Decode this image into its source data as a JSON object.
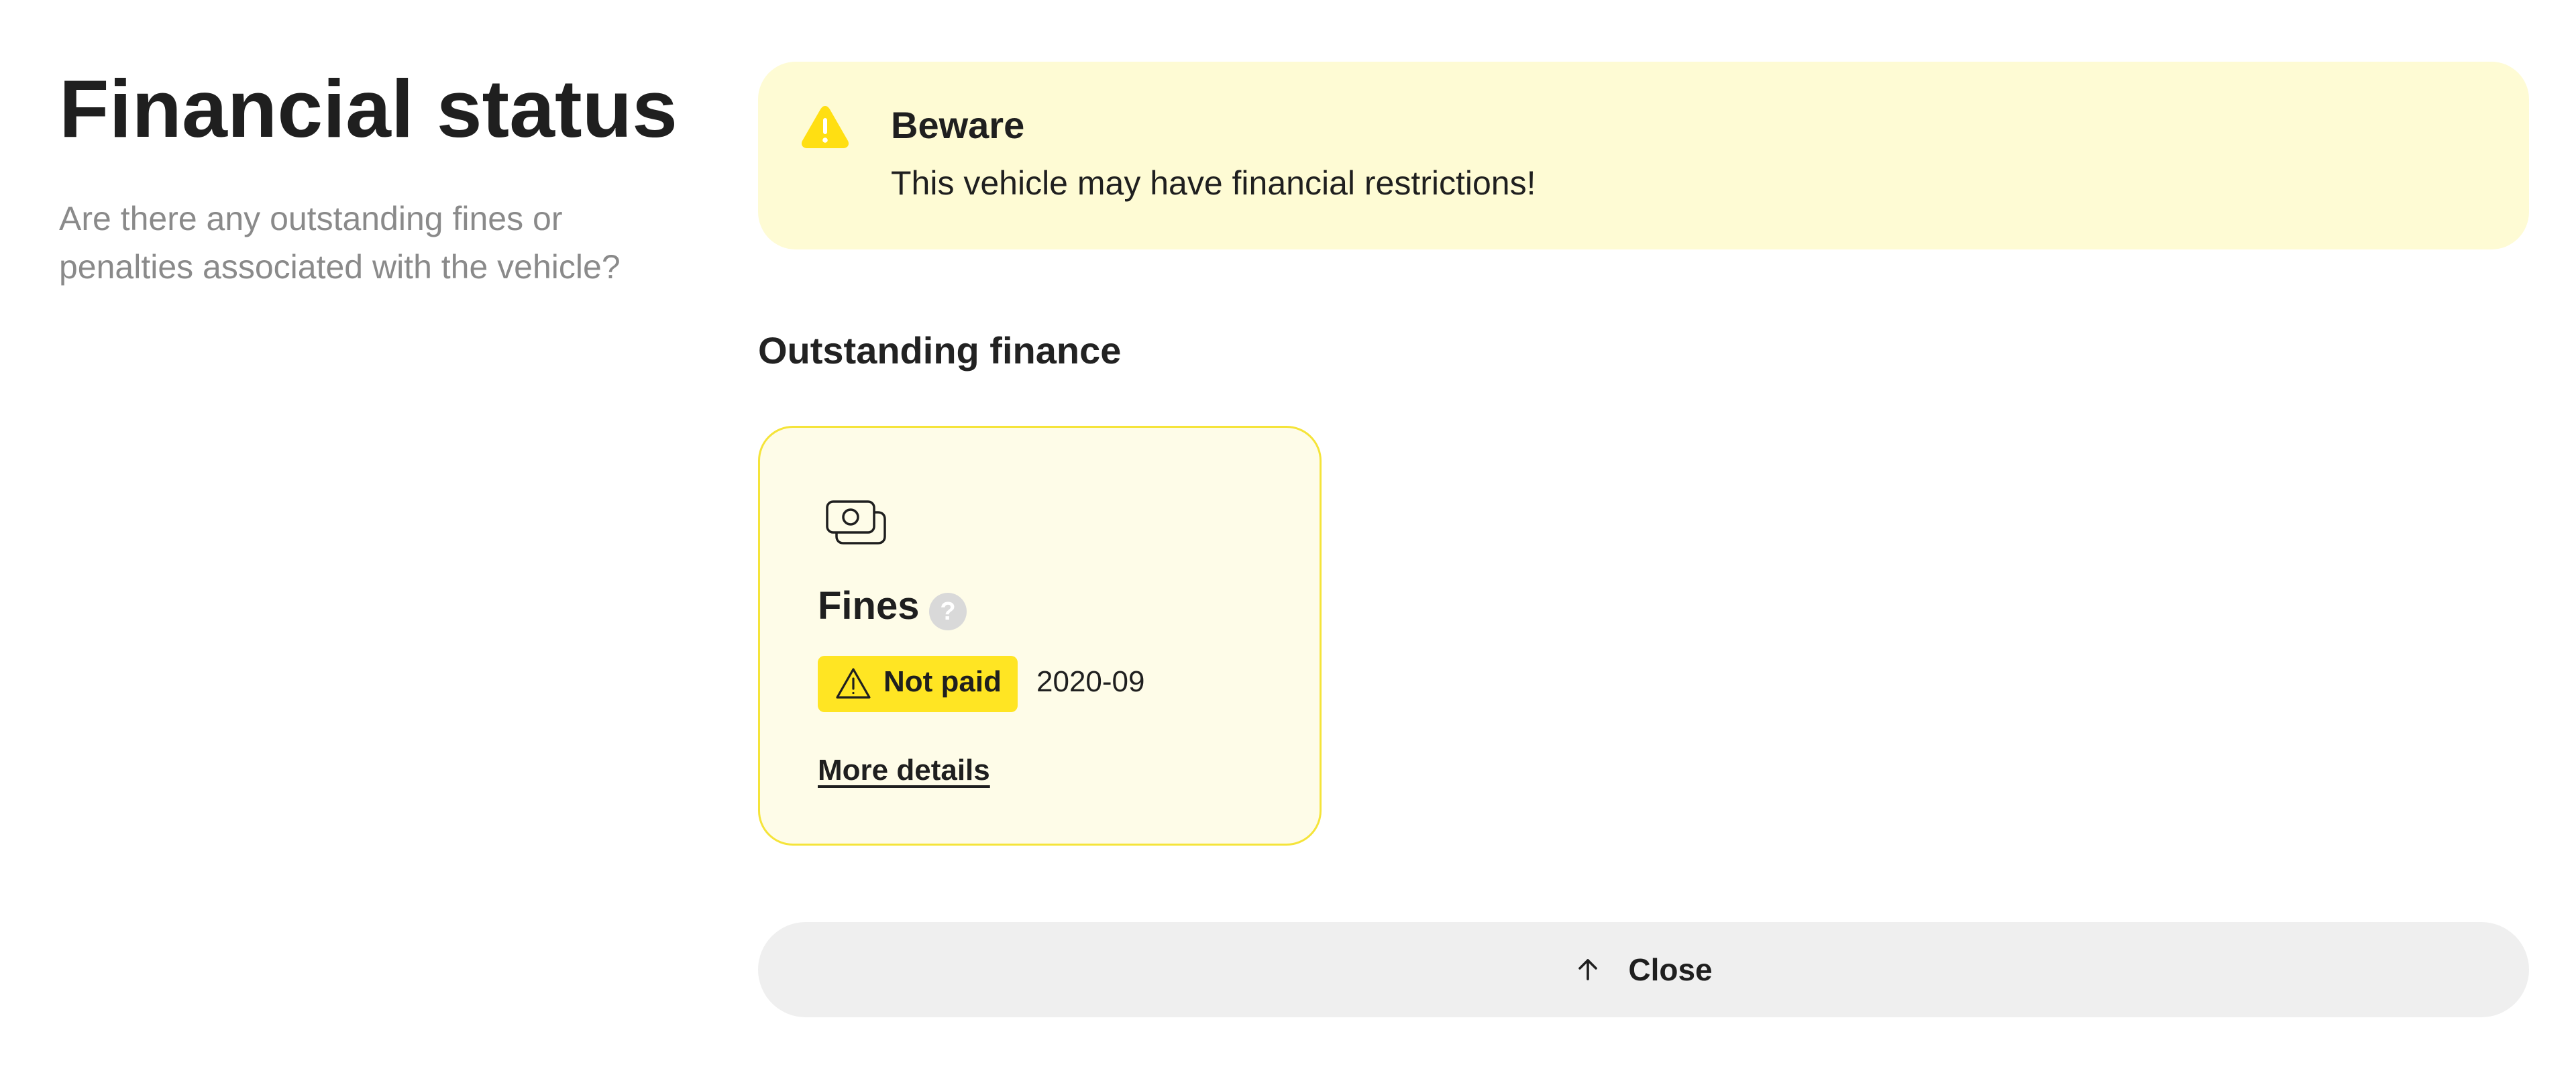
{
  "header": {
    "title": "Financial status",
    "subtitle": "Are there any outstanding fines or penalties associated with the vehicle?"
  },
  "alert": {
    "title": "Beware",
    "text": "This vehicle may have financial restrictions!",
    "icon": "warning-triangle-icon",
    "color": "#fefbd4",
    "icon_color": "#ffdf12"
  },
  "section": {
    "title": "Outstanding finance"
  },
  "card": {
    "icon": "cash-stack-icon",
    "title": "Fines",
    "help_icon_text": "?",
    "status": {
      "label": "Not paid",
      "date": "2020-09",
      "icon": "warning-outline-icon",
      "color": "#ffe523"
    },
    "link_label": "More details",
    "background": "#fefce8",
    "border_color": "#f5e43a"
  },
  "close_button": {
    "label": "Close",
    "icon": "arrow-up-icon"
  }
}
